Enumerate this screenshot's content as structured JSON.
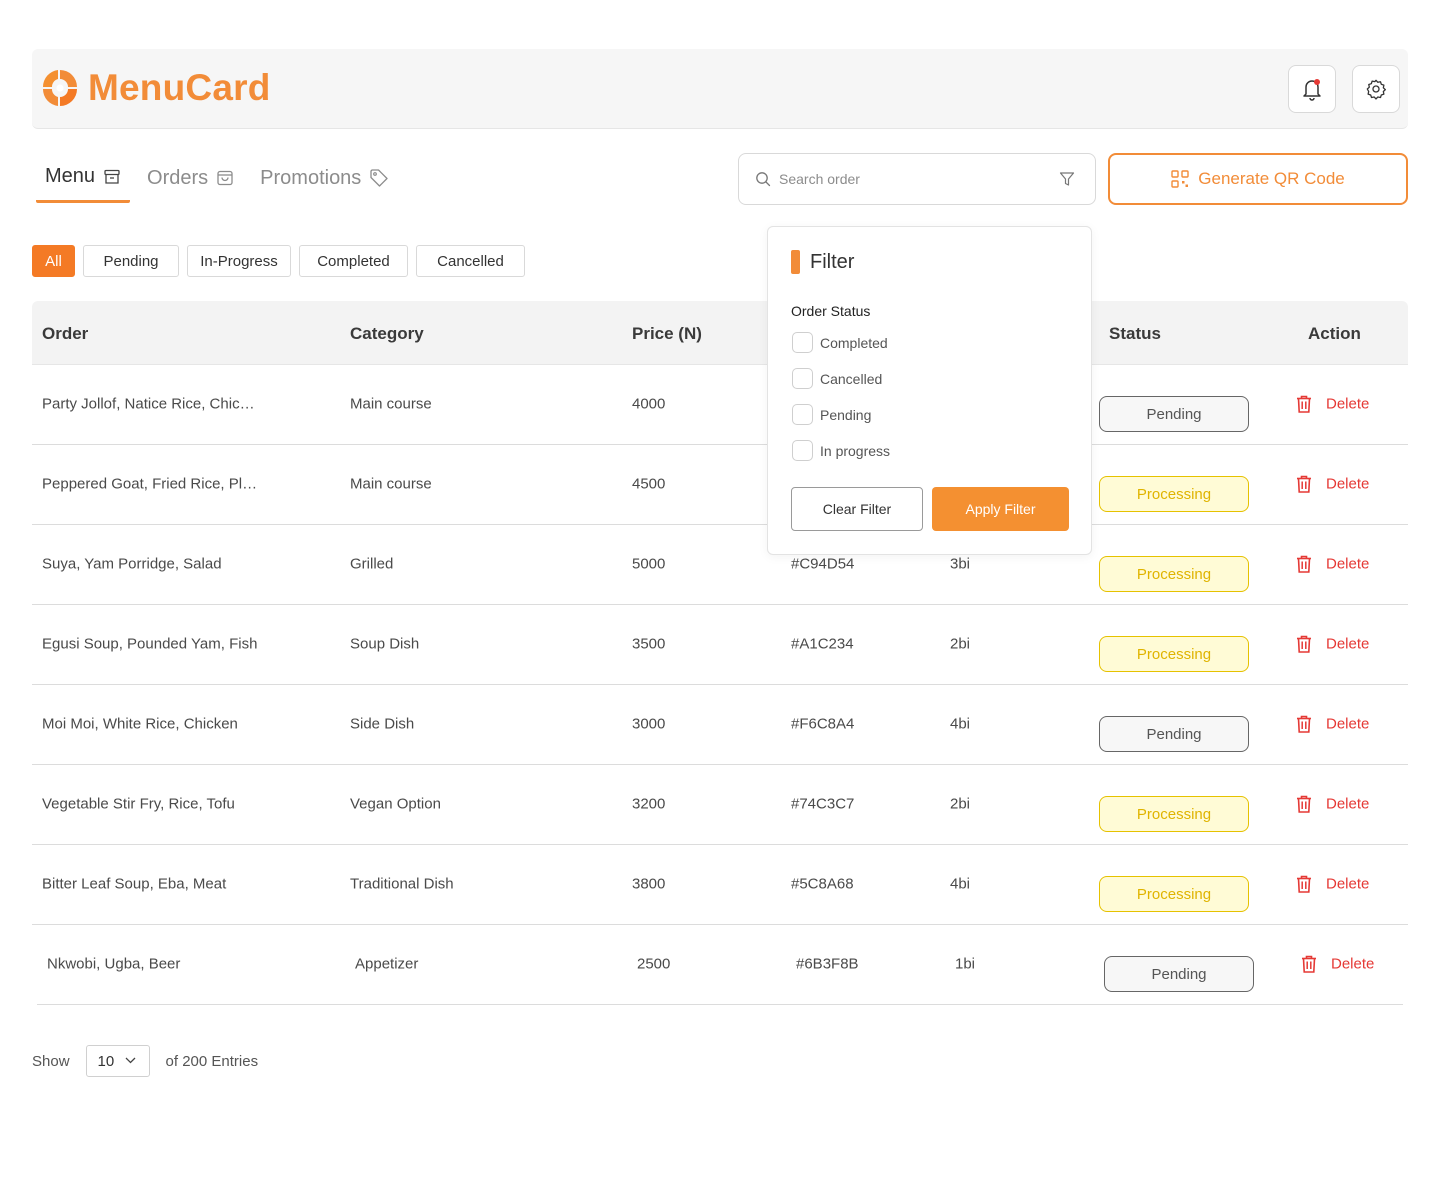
{
  "brand": {
    "name": "MenuCard",
    "accent": "#f28c38"
  },
  "header": {
    "notification_icon": "bell-icon",
    "settings_icon": "gear-icon"
  },
  "tabs": [
    {
      "label": "Menu",
      "icon": "archive-icon",
      "active": true
    },
    {
      "label": "Orders",
      "icon": "bag-icon",
      "active": false
    },
    {
      "label": "Promotions",
      "icon": "tag-icon",
      "active": false
    }
  ],
  "search": {
    "placeholder": "Search order"
  },
  "qr_button": {
    "label": "Generate QR Code"
  },
  "status_filters": [
    {
      "label": "All",
      "active": true
    },
    {
      "label": "Pending",
      "active": false
    },
    {
      "label": "In-Progress",
      "active": false
    },
    {
      "label": "Completed",
      "active": false
    },
    {
      "label": "Cancelled",
      "active": false
    }
  ],
  "table": {
    "columns": [
      "Order",
      "Category",
      "Price (N)",
      "Status",
      "Action"
    ],
    "rows": [
      {
        "order": "Party Jollof, Natice Rice, Chic…",
        "category": "Main course",
        "price": "4000",
        "id": "",
        "qty": "",
        "status": "Pending",
        "action": "Delete"
      },
      {
        "order": "Peppered Goat, Fried Rice, Pl…",
        "category": "Main course",
        "price": "4500",
        "id": "",
        "qty": "",
        "status": "Processing",
        "action": "Delete"
      },
      {
        "order": "Suya, Yam Porridge, Salad",
        "category": "Grilled",
        "price": "5000",
        "id": "#C94D54",
        "qty": "3bi",
        "status": "Processing",
        "action": "Delete"
      },
      {
        "order": "Egusi Soup, Pounded Yam, Fish",
        "category": "Soup Dish",
        "price": "3500",
        "id": "#A1C234",
        "qty": "2bi",
        "status": "Processing",
        "action": "Delete"
      },
      {
        "order": "Moi Moi, White Rice, Chicken",
        "category": "Side Dish",
        "price": "3000",
        "id": "#F6C8A4",
        "qty": "4bi",
        "status": "Pending",
        "action": "Delete"
      },
      {
        "order": "Vegetable Stir Fry, Rice, Tofu",
        "category": "Vegan Option",
        "price": "3200",
        "id": "#74C3C7",
        "qty": "2bi",
        "status": "Processing",
        "action": "Delete"
      },
      {
        "order": "Bitter Leaf Soup, Eba, Meat",
        "category": "Traditional Dish",
        "price": "3800",
        "id": "#5C8A68",
        "qty": "4bi",
        "status": "Processing",
        "action": "Delete"
      },
      {
        "order": "Nkwobi, Ugba, Beer",
        "category": "Appetizer",
        "price": "2500",
        "id": "#6B3F8B",
        "qty": "1bi",
        "status": "Pending",
        "action": "Delete"
      }
    ]
  },
  "footer": {
    "show_label": "Show",
    "page_size": "10",
    "entries_label": "of 200 Entries"
  },
  "filter_panel": {
    "title": "Filter",
    "section_label": "Order Status",
    "options": [
      "Completed",
      "Cancelled",
      "Pending",
      "In progress"
    ],
    "clear_label": "Clear Filter",
    "apply_label": "Apply Filter"
  },
  "colors": {
    "pending_border": "#666666",
    "processing_bg": "#fffbd6",
    "processing_text": "#e0b400",
    "delete": "#e53935"
  }
}
